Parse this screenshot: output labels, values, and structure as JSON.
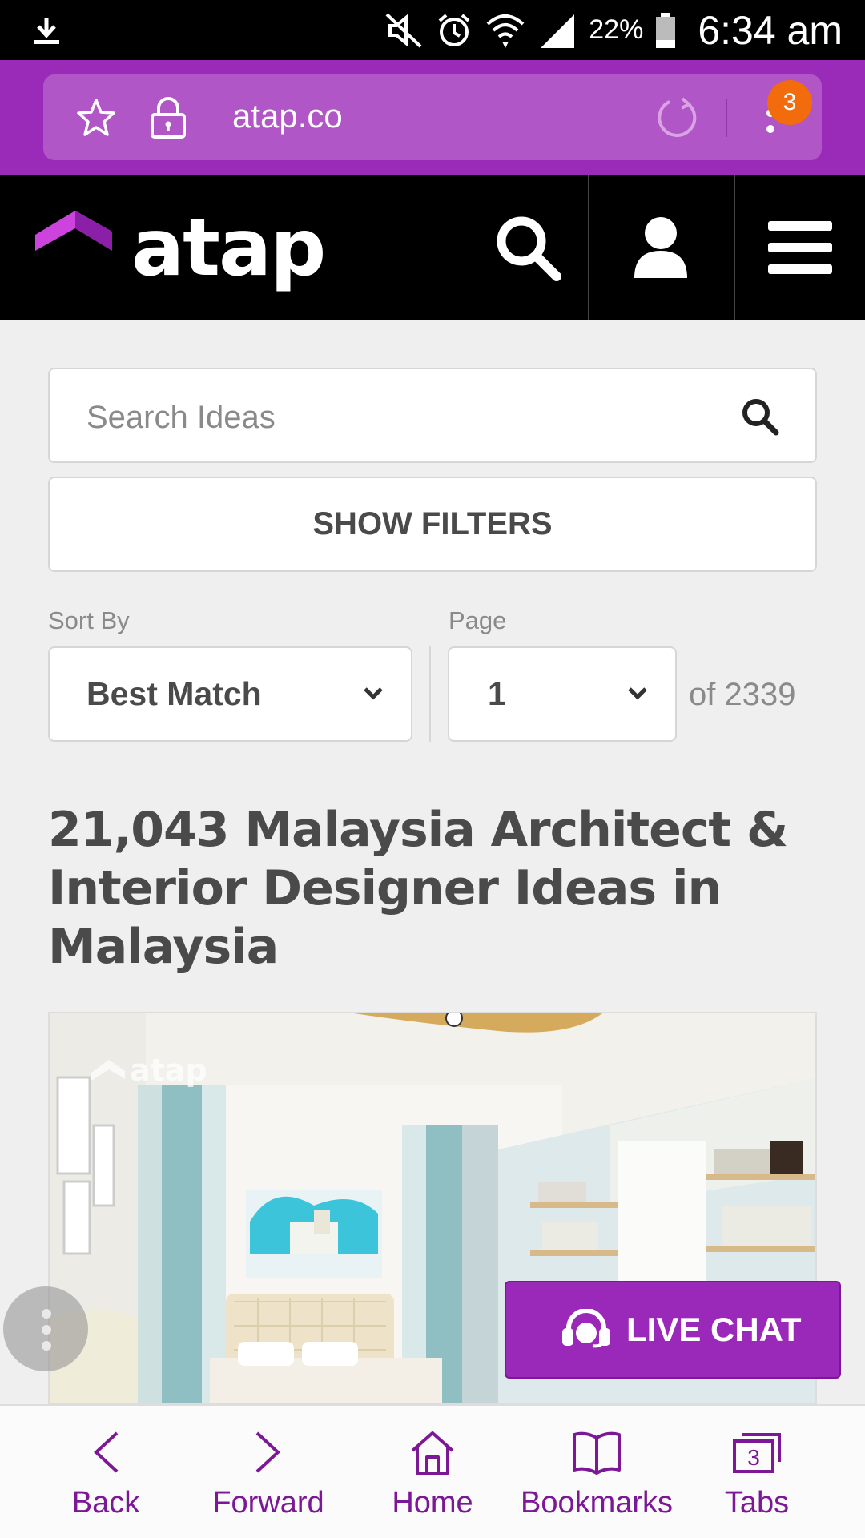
{
  "status_bar": {
    "battery_percent": "22%",
    "time": "6:34 am",
    "icons": [
      "download-icon",
      "mute-icon",
      "alarm-icon",
      "wifi-icon",
      "signal-icon",
      "battery-icon"
    ]
  },
  "browser": {
    "url": "atap.co",
    "menu_badge": "3",
    "bottom_nav": {
      "back": "Back",
      "forward": "Forward",
      "home": "Home",
      "bookmarks": "Bookmarks",
      "tabs": "Tabs",
      "tab_count": "3"
    }
  },
  "site": {
    "brand": "atap",
    "brand_color": "#cc44dd",
    "accent_color": "#9a28b8"
  },
  "search": {
    "placeholder": "Search Ideas"
  },
  "filters": {
    "button_label": "SHOW FILTERS"
  },
  "sort": {
    "label": "Sort By",
    "selected": "Best Match"
  },
  "pagination": {
    "label": "Page",
    "selected": "1",
    "of_total": "of 2339"
  },
  "headline": "21,043 Malaysia Architect & Interior Designer Ideas in Malaysia",
  "image": {
    "watermark": "atap"
  },
  "live_chat": {
    "label": "LIVE CHAT"
  }
}
